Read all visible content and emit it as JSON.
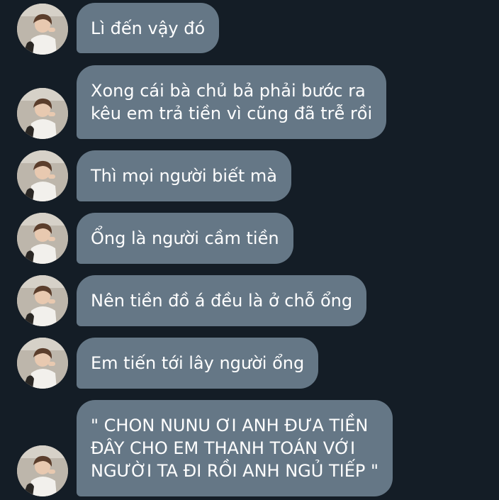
{
  "colors": {
    "background": "#141d26",
    "bubble": "#657786",
    "text": "#ffffff"
  },
  "messages": [
    {
      "text": "Lì đến vậy đó",
      "avatar": "profile-photo"
    },
    {
      "text": "Xong cái bà chủ bả phải bước ra\nkêu em trả tiền vì cũng đã trễ rồi",
      "avatar": "profile-photo"
    },
    {
      "text": "Thì mọi người biết mà",
      "avatar": "profile-photo"
    },
    {
      "text": "Ổng là người cầm tiền",
      "avatar": "profile-photo"
    },
    {
      "text": "Nên tiền đồ á đều là ở chỗ ổng",
      "avatar": "profile-photo"
    },
    {
      "text": "Em tiến tới lây người ổng",
      "avatar": "profile-photo"
    },
    {
      "text": "\" CHON NUNU ƠI ANH ĐƯA TIỀN\nĐÂY CHO EM THANH TOÁN VỚI\nNGƯỜI TA ĐI RỒI ANH NGỦ TIẾP \"",
      "avatar": "profile-photo"
    }
  ]
}
